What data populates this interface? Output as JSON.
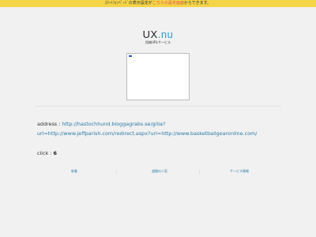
{
  "notice": {
    "prefix": "ｽﾏｰﾄﾌｫﾝﾍﾟｰｼﾞの表示設定が",
    "link": "こちらの設定画面",
    "suffix": "からできます。"
  },
  "brand": {
    "logo_main": "UX",
    "logo_dot": ".",
    "logo_tld": "nu",
    "tagline": "短縮URLサービス"
  },
  "detail": {
    "address_label": "address :",
    "address_url": "http://hastochhund.bloggagrabs.se/gilla?url=http://www.jeffparish.com/redirect.aspx?url=http://www.basketballgearonline.com/",
    "click_label": "click :",
    "click_count": "6"
  },
  "footer": {
    "links": [
      "新着",
      "週間の人気",
      "サービス情報"
    ]
  },
  "colors": {
    "notice_bg": "#f5d547",
    "accent": "#2f9ec8",
    "link": "#2a7aa6",
    "page_bg": "#f1f1f1"
  }
}
